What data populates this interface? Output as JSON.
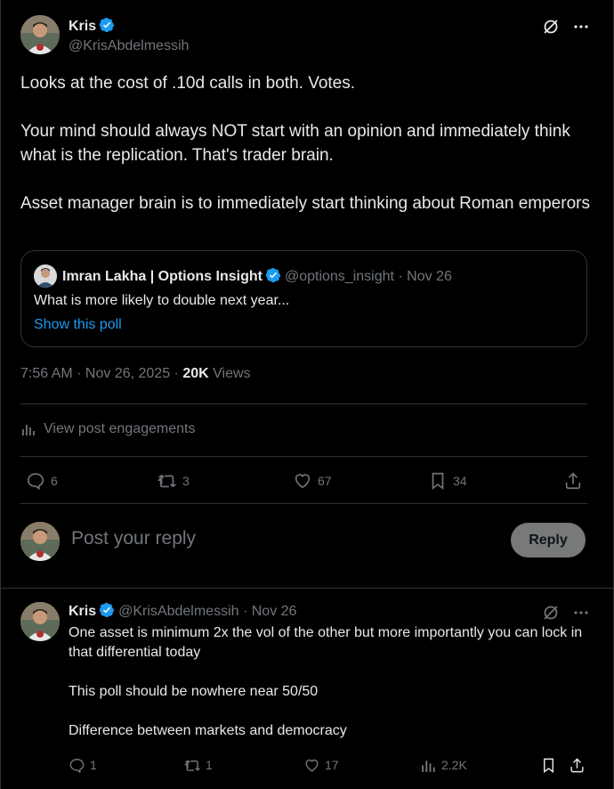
{
  "main_post": {
    "author_name": "Kris",
    "author_handle": "@KrisAbdelmessih",
    "paragraphs": [
      "Looks at the cost of .10d calls in both. Votes.",
      "Your mind should always NOT start with an opinion and immediately think what is the replication. That's trader brain.",
      "Asset manager brain is to immediately start thinking about Roman emperors"
    ],
    "quote": {
      "author_name": "Imran Lakha | Options Insight",
      "author_meta": "@options_insight · Nov 26",
      "text": "What is more likely to double next year...",
      "link": "Show this poll"
    },
    "time": "7:56 AM · Nov 26, 2025 · ",
    "views_count": "20K",
    "views_label": " Views",
    "engagements_label": "View post engagements",
    "actions": {
      "replies": "6",
      "reposts": "3",
      "likes": "67",
      "bookmarks": "34"
    }
  },
  "reply_composer": {
    "placeholder": "Post your reply",
    "button": "Reply"
  },
  "reply_post": {
    "author_name": "Kris",
    "author_meta": "@KrisAbdelmessih · Nov 26",
    "paragraphs": [
      "One asset is minimum 2x the vol of the other but more importantly you can lock in that differential today",
      "This poll should be nowhere near 50/50",
      "Difference between markets and democracy"
    ],
    "actions": {
      "replies": "1",
      "reposts": "1",
      "likes": "17",
      "views": "2.2K"
    }
  },
  "colors": {
    "accent": "#1d9bf0",
    "muted": "#71767b",
    "text": "#e7e9ea",
    "border": "#2f3336"
  }
}
